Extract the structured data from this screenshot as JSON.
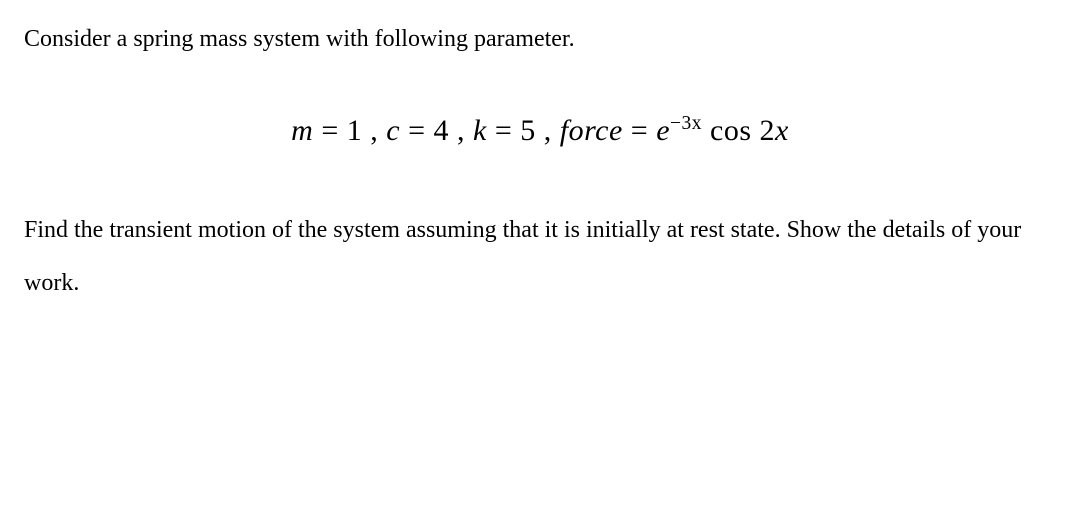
{
  "problem": {
    "intro": "Consider a spring mass system with following parameter.",
    "equation": {
      "m_var": "m",
      "eq1": " = ",
      "m_val": "1",
      "sep1": " , ",
      "c_var": "c",
      "eq2": " = ",
      "c_val": "4",
      "sep2": " , ",
      "k_var": "k",
      "eq3": " = ",
      "k_val": "5",
      "sep3": " ,  ",
      "force_label": "force",
      "eq4": " = ",
      "e_base": "e",
      "e_exp": "−3x",
      "space": " ",
      "cos_label": "cos ",
      "cos_arg": "2",
      "cos_x": "x"
    },
    "question": "Find the transient motion of the system assuming that it is initially at rest state. Show the details of your work."
  }
}
